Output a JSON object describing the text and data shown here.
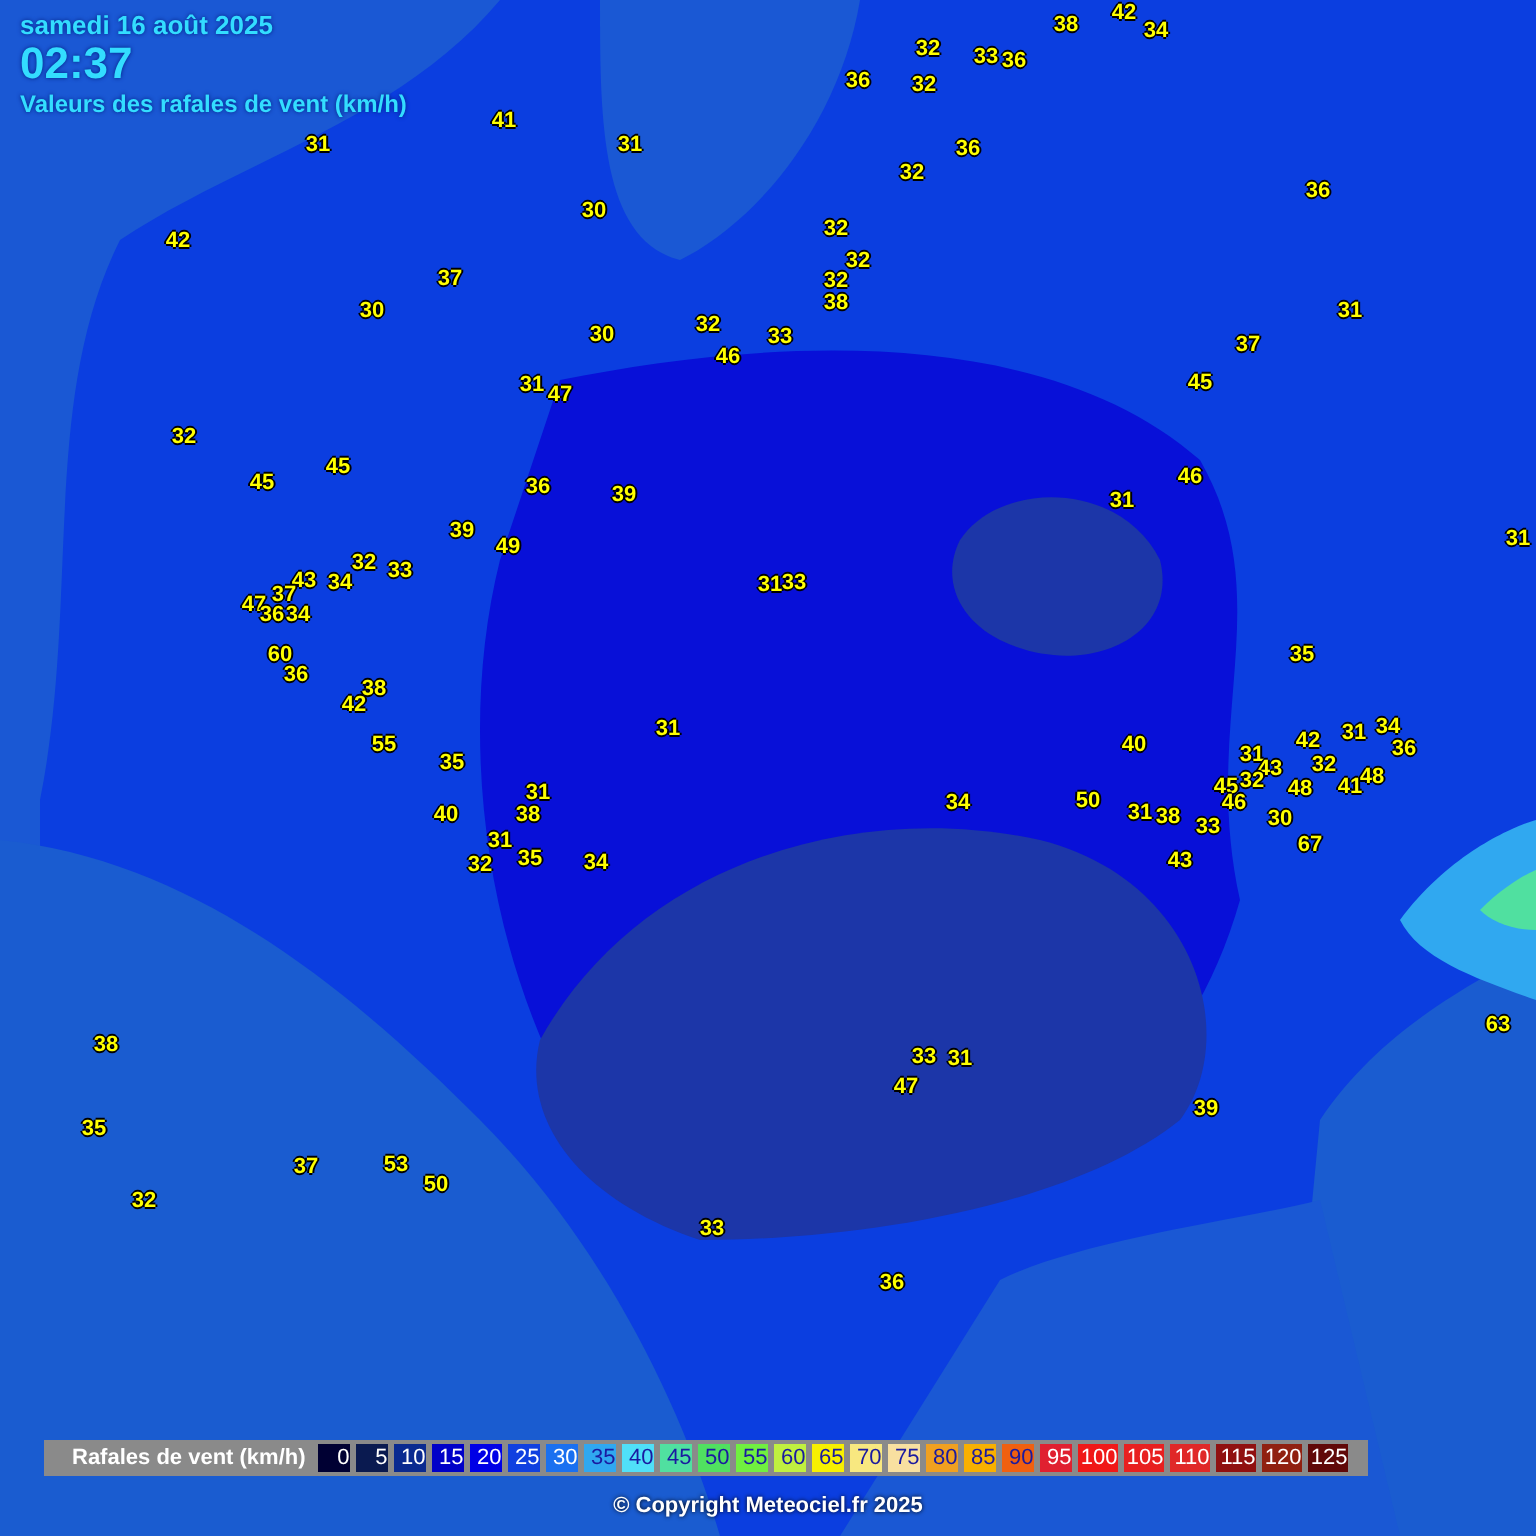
{
  "header": {
    "date": "samedi 16 août 2025",
    "time": "02:37",
    "subtitle": "Valeurs des rafales de vent (km/h)"
  },
  "stations": [
    "32",
    "33",
    "36",
    "38",
    "42",
    "34",
    "36",
    "32",
    "41",
    "31",
    "31",
    "36",
    "32",
    "36",
    "30",
    "42",
    "32",
    "32",
    "37",
    "32",
    "38",
    "30",
    "30",
    "32",
    "33",
    "46",
    "31",
    "37",
    "31",
    "47",
    "45",
    "32",
    "45",
    "45",
    "36",
    "39",
    "46",
    "31",
    "39",
    "49",
    "31",
    "32",
    "33",
    "43",
    "34",
    "37",
    "47",
    "36",
    "34",
    "31",
    "33",
    "60",
    "36",
    "38",
    "35",
    "42",
    "31",
    "55",
    "40",
    "42",
    "31",
    "34",
    "36",
    "35",
    "31",
    "43",
    "32",
    "48",
    "45",
    "32",
    "48",
    "41",
    "46",
    "31",
    "40",
    "38",
    "34",
    "50",
    "31",
    "38",
    "33",
    "30",
    "31",
    "32",
    "35",
    "34",
    "43",
    "67",
    "38",
    "63",
    "33",
    "31",
    "47",
    "39",
    "35",
    "37",
    "53",
    "50",
    "32",
    "33",
    "36"
  ],
  "legend": {
    "label": "Rafales de vent (km/h)",
    "steps": [
      {
        "value": "0",
        "color": "#000033"
      },
      {
        "value": "5",
        "color": "#0a1a50"
      },
      {
        "value": "10",
        "color": "#0a2a90"
      },
      {
        "value": "15",
        "color": "#0000c8"
      },
      {
        "value": "20",
        "color": "#0000e6"
      },
      {
        "value": "25",
        "color": "#1040e0"
      },
      {
        "value": "30",
        "color": "#1a70f0"
      },
      {
        "value": "35",
        "color": "#30a8f0"
      },
      {
        "value": "40",
        "color": "#50e0f8"
      },
      {
        "value": "45",
        "color": "#50e0a0"
      },
      {
        "value": "50",
        "color": "#50e060"
      },
      {
        "value": "55",
        "color": "#70f040"
      },
      {
        "value": "60",
        "color": "#c0f040"
      },
      {
        "value": "65",
        "color": "#f8f000"
      },
      {
        "value": "70",
        "color": "#f8e880"
      },
      {
        "value": "75",
        "color": "#f8e0a0"
      },
      {
        "value": "80",
        "color": "#f0a020"
      },
      {
        "value": "85",
        "color": "#f8b000"
      },
      {
        "value": "90",
        "color": "#f06010"
      },
      {
        "value": "95",
        "color": "#e02030"
      },
      {
        "value": "100",
        "color": "#f01818"
      },
      {
        "value": "105",
        "color": "#e82020"
      },
      {
        "value": "110",
        "color": "#e02828"
      },
      {
        "value": "115",
        "color": "#901010"
      },
      {
        "value": "120",
        "color": "#902010"
      },
      {
        "value": "125",
        "color": "#600808"
      }
    ]
  },
  "copyright": "© Copyright Meteociel.fr 2025"
}
